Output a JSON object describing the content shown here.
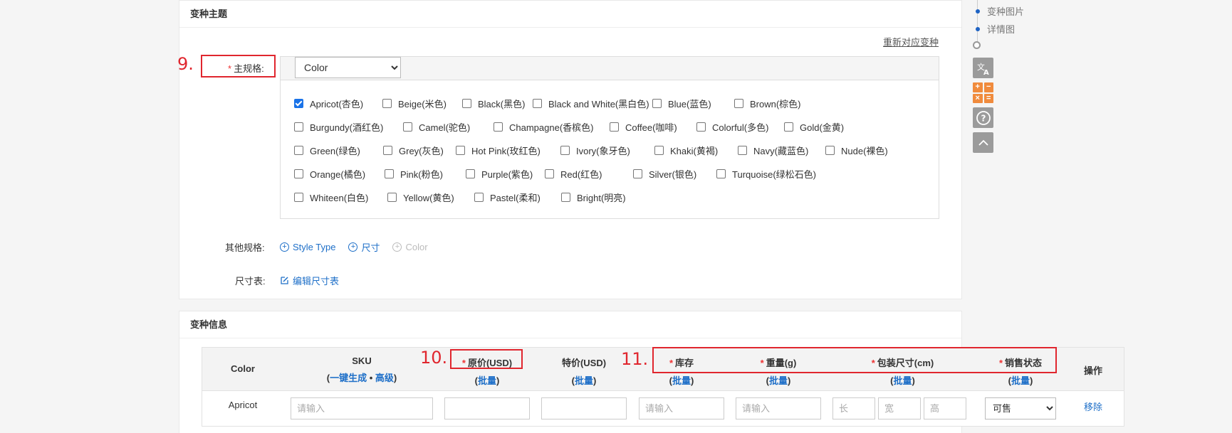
{
  "theme_panel": {
    "title": "变种主题",
    "reset_link": "重新对应变种",
    "main_spec_label": "主规格:",
    "main_spec_selected": "Color",
    "colors": [
      [
        {
          "label": "Apricot(杏色)",
          "checked": true
        },
        {
          "label": "Beige(米色)",
          "checked": false
        },
        {
          "label": "Black(黑色)",
          "checked": false
        },
        {
          "label": "Black and White(黑白色)",
          "checked": false
        },
        {
          "label": "Blue(蓝色)",
          "checked": false
        },
        {
          "label": "Brown(棕色)",
          "checked": false
        }
      ],
      [
        {
          "label": "Burgundy(酒红色)",
          "checked": false
        },
        {
          "label": "Camel(驼色)",
          "checked": false
        },
        {
          "label": "Champagne(香槟色)",
          "checked": false
        },
        {
          "label": "Coffee(咖啡)",
          "checked": false
        },
        {
          "label": "Colorful(多色)",
          "checked": false
        },
        {
          "label": "Gold(金黄)",
          "checked": false
        }
      ],
      [
        {
          "label": "Green(绿色)",
          "checked": false
        },
        {
          "label": "Grey(灰色)",
          "checked": false
        },
        {
          "label": "Hot Pink(玫红色)",
          "checked": false
        },
        {
          "label": "Ivory(象牙色)",
          "checked": false
        },
        {
          "label": "Khaki(黄褐)",
          "checked": false
        },
        {
          "label": "Navy(藏蓝色)",
          "checked": false
        },
        {
          "label": "Nude(裸色)",
          "checked": false
        }
      ],
      [
        {
          "label": "Orange(橘色)",
          "checked": false
        },
        {
          "label": "Pink(粉色)",
          "checked": false
        },
        {
          "label": "Purple(紫色)",
          "checked": false
        },
        {
          "label": "Red(红色)",
          "checked": false
        },
        {
          "label": "Silver(银色)",
          "checked": false
        },
        {
          "label": "Turquoise(绿松石色)",
          "checked": false
        }
      ],
      [
        {
          "label": "Whiteen(白色)",
          "checked": false
        },
        {
          "label": "Yellow(黄色)",
          "checked": false
        },
        {
          "label": "Pastel(柔和)",
          "checked": false
        },
        {
          "label": "Bright(明亮)",
          "checked": false
        }
      ]
    ],
    "other_spec_label": "其他规格:",
    "other_specs": [
      {
        "label": "Style Type",
        "enabled": true
      },
      {
        "label": "尺寸",
        "enabled": true
      },
      {
        "label": "Color",
        "enabled": false
      }
    ],
    "size_table_label": "尺寸表:",
    "size_table_link": "编辑尺寸表"
  },
  "side_nav": {
    "items": [
      "变种图片",
      "详情图"
    ],
    "translate_icon": "translate-icon",
    "calculator_icon": "calculator-icon",
    "help_icon": "help-icon",
    "top_icon": "back-to-top-icon"
  },
  "annotations": {
    "n9": "9.",
    "n10": "10.",
    "n11": "11."
  },
  "variant_panel": {
    "title": "变种信息",
    "headers": {
      "color": "Color",
      "sku": "SKU",
      "sku_generate": "一键生成",
      "sku_bullet": "•",
      "sku_advanced": "高级",
      "price": "原价(USD)",
      "special_price": "特价(USD)",
      "stock": "库存",
      "weight": "重量(g)",
      "package": "包装尺寸(cm)",
      "status": "销售状态",
      "action": "操作",
      "batch": "批量"
    },
    "row": {
      "color": "Apricot",
      "sku_placeholder": "请输入",
      "stock_placeholder": "请输入",
      "weight_placeholder": "请输入",
      "len_placeholder": "长",
      "wid_placeholder": "宽",
      "hei_placeholder": "高",
      "status_value": "可售",
      "remove": "移除"
    }
  },
  "colors": {
    "accent": "#1e6fc8",
    "annotation_red": "#e0262e",
    "required_red": "#e33"
  }
}
